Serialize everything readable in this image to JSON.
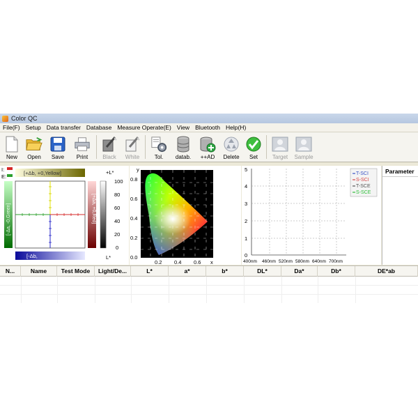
{
  "window": {
    "title": "Color QC"
  },
  "menu": [
    "File(F)",
    "Setup",
    "Data transfer",
    "Database",
    "Measure Operate(E)",
    "View",
    "Bluetooth",
    "Help(H)"
  ],
  "toolbar": {
    "new": "New",
    "open": "Open",
    "save": "Save",
    "print": "Print",
    "black": "Black",
    "white": "White",
    "tol": "Tol.",
    "datab": "datab.",
    "add": "++AD",
    "delete": "Delete",
    "set": "Set",
    "target": "Target",
    "sample": "Sample"
  },
  "lab_plot": {
    "indicator_i": "I:",
    "indicator_e": "E:",
    "top_label": "[+Δb, +0,Yellow]",
    "bottom_label": "[-Δb,",
    "left_label": "[-Δa, -0,Green]",
    "right_label": "[+Δa, +0,Red]",
    "l_axis_top": "+L*",
    "l_axis_bottom": "L*",
    "l_ticks": [
      "100",
      "80",
      "60",
      "40",
      "20",
      "0"
    ]
  },
  "cie_plot": {
    "y_label": "y",
    "x_label": "x",
    "y_ticks": [
      "0.8",
      "0.6",
      "0.4",
      "0.2",
      "0.0"
    ],
    "x_ticks": [
      "0.2",
      "0.4",
      "0.6"
    ]
  },
  "spectrum_plot": {
    "y_ticks": [
      "5",
      "4",
      "3",
      "2",
      "1",
      "0"
    ],
    "x_ticks": [
      "400nm",
      "460nm",
      "520nm",
      "580nm",
      "640nm",
      "700nm"
    ],
    "legend": [
      {
        "label": "T-SCI",
        "color": "#3a53c5"
      },
      {
        "label": "S-SCI",
        "color": "#d64545"
      },
      {
        "label": "T-SCE",
        "color": "#555555"
      },
      {
        "label": "S-SCE",
        "color": "#2fbf3a"
      }
    ]
  },
  "param_panel": {
    "title": "Parameter"
  },
  "table": {
    "columns": [
      "N...",
      "Name",
      "Test Mode",
      "Light/De...",
      "L*",
      "a*",
      "b*",
      "DL*",
      "Da*",
      "Db*",
      "DE*ab"
    ]
  },
  "colors": {
    "titlebar": "#b6c7e0",
    "toolbar_bg": "#f5f4ef",
    "app_bg": "#ece9d8"
  }
}
